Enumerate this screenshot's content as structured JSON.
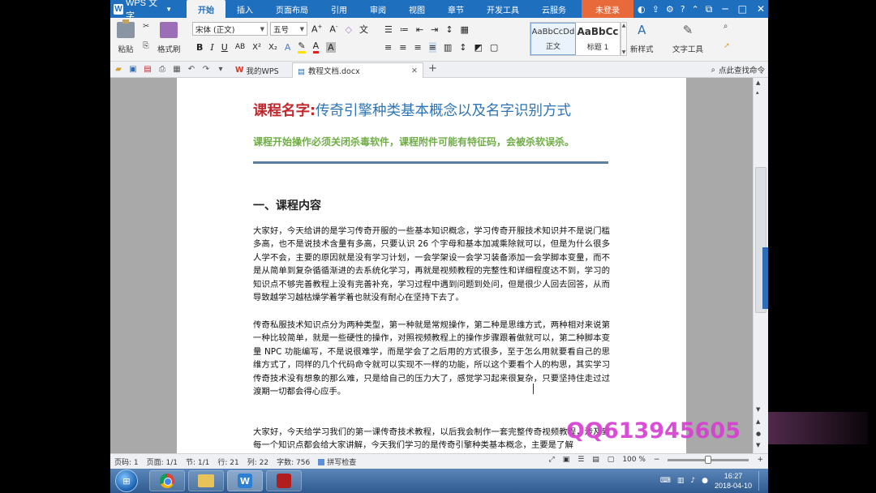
{
  "app": {
    "name": "WPS 文字"
  },
  "menu": [
    "开始",
    "插入",
    "页面布局",
    "引用",
    "审阅",
    "视图",
    "章节",
    "开发工具",
    "云服务"
  ],
  "login_label": "未登录",
  "window_controls": [
    "─",
    "□",
    "✕"
  ],
  "ribbon": {
    "paste": "粘贴",
    "format_painter": "格式刷",
    "font_name": "宋体 (正文)",
    "font_size": "五号",
    "styles": [
      {
        "sample": "AaBbCcDd",
        "label": "正文"
      },
      {
        "sample": "AaBbCc",
        "label": "标题 1"
      }
    ],
    "new_style": "新样式",
    "text_tool": "文字工具"
  },
  "tabs": {
    "home": "我的WPS",
    "doc": "教程文档.docx",
    "find": "点此查找命令"
  },
  "document": {
    "title_red": "课程名字:",
    "title_blue": "传奇引擎种类基本概念以及名字识别方式",
    "warning": "课程开始操作必须关闭杀毒软件，课程附件可能有特征码，会被杀软误杀。",
    "heading": "一、课程内容",
    "paragraphs": [
      "大家好，今天给讲的是学习传奇开服的一些基本知识概念，学习传奇开服技术知识并不是说门槛多高，也不是说技术含量有多高，只要认识 26 个字母和基本加减乘除就可以，但是为什么很多人学不会，主要的原因就是没有学习计划，一会学架设一会学习装备添加一会学脚本变量，而不是从简单到复杂循循渐进的去系统化学习，再就是视频教程的完整性和详细程度达不到，学习的知识点不够完善教程上没有完善补充，学习过程中遇到问题到处问，但是很少人回去回答，从而导致越学习越枯燥学着学着也就没有耐心在坚持下去了。",
      "传奇私服技术知识点分为两种类型，第一种就是常规操作，第二种是思维方式，两种相对来说第一种比较简单，就是一些硬性的操作，对照视频教程上的操作步骤跟着做就可以，第二种脚本变量 NPC 功能编写，不是说很难学，而是学会了之后用的方式很多，至于怎么用就要看自己的思维方式了，同样的几个代码命令就可以实现不一样的功能，所以这个要看个人的构思，其实学习传奇技术没有想象的那么难，只是给自己的压力大了，感觉学习起来很复杂，只要坚持住走过过渡期一切都会得心应手。",
      "大家好，今天给学习我们的第一课传奇技术教程，以后我会制作一套完整传奇视频教程，涉及到每一个知识点都会给大家讲解，今天我们学习的是传奇引擎种类基本概念，主要是了解"
    ]
  },
  "status": {
    "page": "页码: 1",
    "pages": "页面: 1/1",
    "section": "节: 1/1",
    "row": "行: 21",
    "col": "列: 22",
    "words": "字数: 756",
    "spell": "拼写检查",
    "zoom": "100 %",
    "zoom_level": 0.5
  },
  "watermark": "QQ613945605",
  "taskbar": {
    "time": "16:27",
    "date": "2018-04-10"
  },
  "colors": {
    "accent": "#1f6fbf",
    "login": "#e8693a",
    "title_red": "#c0282e",
    "title_blue": "#2e74b5",
    "warning_green": "#70ad47",
    "watermark": "#d73fd3"
  }
}
